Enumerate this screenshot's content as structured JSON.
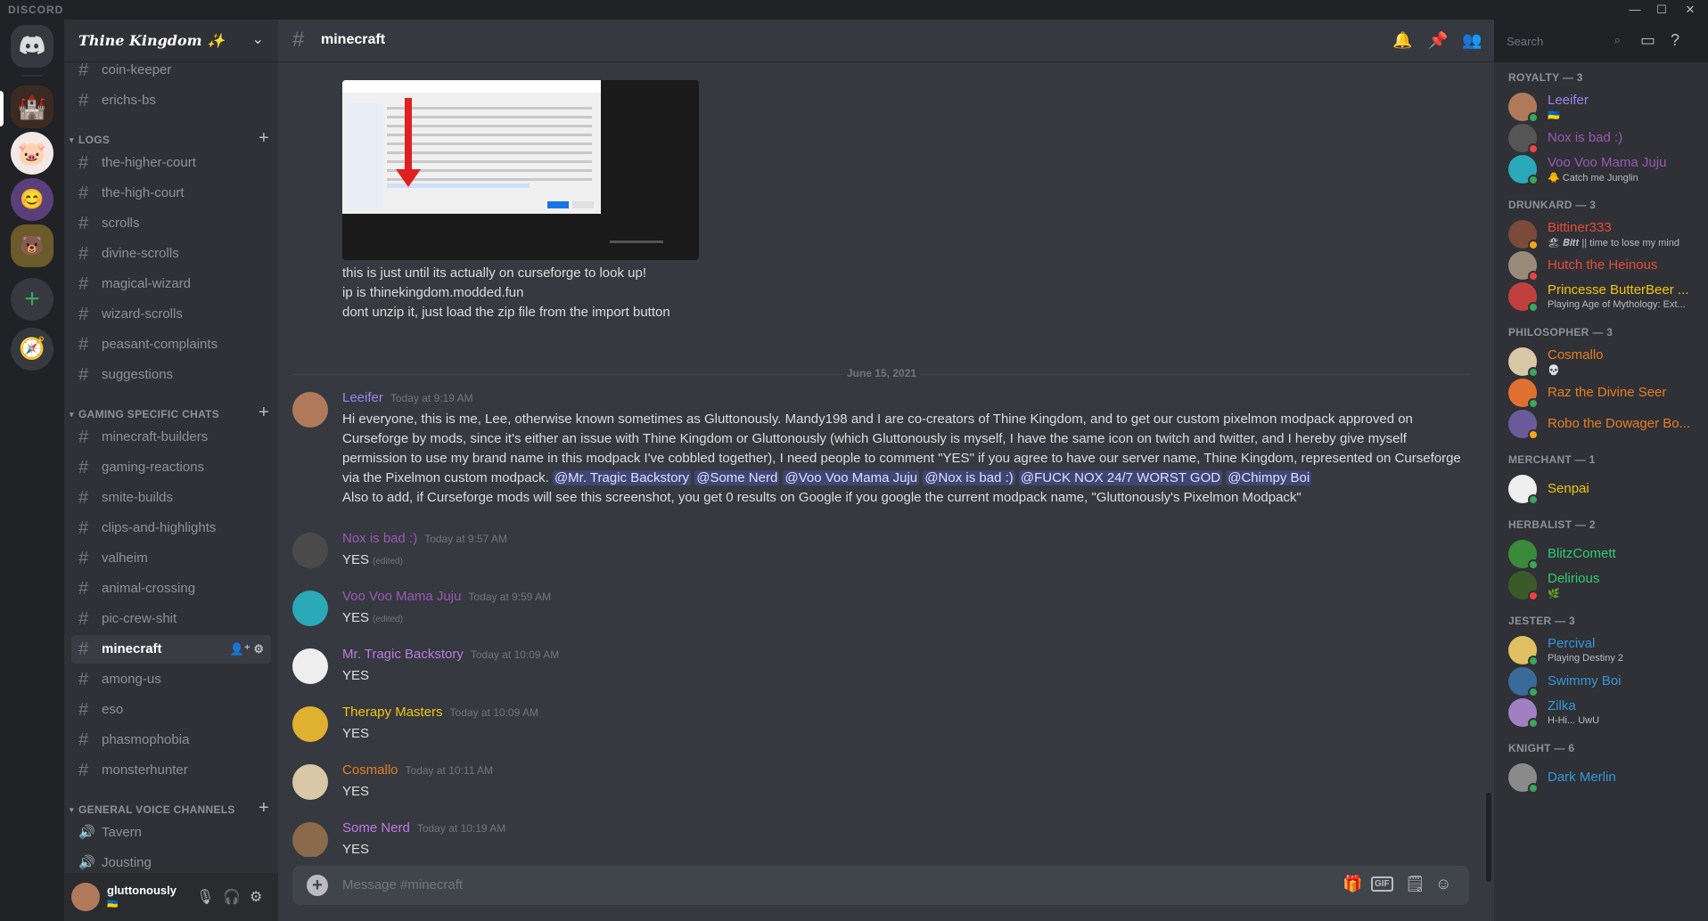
{
  "app": {
    "brand": "DISCORD"
  },
  "server": {
    "name": "𝑻𝒉𝒊𝒏𝒆 𝑲𝒊𝒏𝒈𝒅𝒐𝒎 ✨"
  },
  "channels": {
    "top": [
      "coin-keeper",
      "erichs-bs"
    ],
    "logs_label": "LOGS",
    "logs": [
      "the-higher-court",
      "the-high-court",
      "scrolls",
      "divine-scrolls",
      "magical-wizard",
      "wizard-scrolls",
      "peasant-complaints",
      "suggestions"
    ],
    "gaming_label": "GAMING SPECIFIC CHATS",
    "gaming": [
      "minecraft-builders",
      "gaming-reactions",
      "smite-builds",
      "clips-and-highlights",
      "valheim",
      "animal-crossing",
      "pic-crew-shit",
      "minecraft",
      "among-us",
      "eso",
      "phasmophobia",
      "monsterhunter"
    ],
    "voice_label": "GENERAL VOICE CHANNELS",
    "voice": [
      "Tavern",
      "Jousting"
    ]
  },
  "user": {
    "name": "gluttonously",
    "badge": "🇺🇦"
  },
  "header": {
    "channel": "minecraft",
    "search_placeholder": "Search"
  },
  "attachment_text": [
    "this is just until its actually on curseforge to look up!",
    "ip is thinekingdom.modded.fun",
    "dont unzip it, just load the zip file from the import button"
  ],
  "date_divider": "June 15, 2021",
  "messages": [
    {
      "author": "Leeifer",
      "color": "#9b84ec",
      "time": "Today at 9:19 AM",
      "text": "Hi everyone, this is me, Lee, otherwise known sometimes as Gluttonously. Mandy198 and I are co-creators of Thine Kingdom, and to get our custom pixelmon modpack approved on Curseforge by mods, since it's either an issue with Thine Kingdom or Gluttonously (which Gluttonously is myself, I have the same icon on twitch and twitter, and I hereby give myself permission to use my brand name in this modpack I've cobbled together), I need people to comment \"YES\" if you agree to have our server name, Thine Kingdom, represented on Curseforge via the Pixelmon custom modpack.",
      "mentions": [
        "@Mr. Tragic Backstory",
        "@Some Nerd",
        "@Voo Voo Mama Juju",
        "@Nox is bad :)",
        "@FUCK NOX 24/7 WORST GOD",
        "@Chimpy Boi"
      ],
      "text2": "Also to add, if Curseforge mods will see this screenshot, you get 0 results on Google if you google the current modpack name, \"Gluttonously's Pixelmon Modpack\""
    },
    {
      "author": "Nox is bad :)",
      "color": "#9b59b6",
      "time": "Today at 9:57 AM",
      "text": "YES",
      "edited": "(edited)"
    },
    {
      "author": "Voo Voo Mama Juju",
      "color": "#9b59b6",
      "time": "Today at 9:59 AM",
      "text": "YES",
      "edited": "(edited)"
    },
    {
      "author": "Mr. Tragic Backstory",
      "color": "#b87ce0",
      "time": "Today at 10:09 AM",
      "text": "YES"
    },
    {
      "author": "Therapy Masters",
      "color": "#f1c40f",
      "time": "Today at 10:09 AM",
      "text": "YES"
    },
    {
      "author": "Cosmallo",
      "color": "#e67e22",
      "time": "Today at 10:11 AM",
      "text": "YES"
    },
    {
      "author": "Some Nerd",
      "color": "#c278e8",
      "time": "Today at 10:19 AM",
      "text": "YES"
    }
  ],
  "composer": {
    "placeholder": "Message #minecraft",
    "gif": "GIF"
  },
  "members": [
    {
      "role": "ROYALTY — 3",
      "list": [
        {
          "name": "Leeifer",
          "color": "#9b84ec",
          "status": "🇺🇦",
          "dot": "#3ba55d"
        },
        {
          "name": "Nox is bad :)",
          "color": "#9b59b6",
          "status": "",
          "dot": "#ed4245"
        },
        {
          "name": "Voo Voo Mama Juju",
          "color": "#9b59b6",
          "status": "🐥 Catch me Junglin",
          "dot": "#3ba55d"
        }
      ]
    },
    {
      "role": "DRUNKARD — 3",
      "list": [
        {
          "name": "Bittiner333",
          "color": "#e74c3c",
          "status": "🏖 𝑩𝒊𝒕𝒕 || time to lose my mind",
          "dot": "#faa61a"
        },
        {
          "name": "Hutch the Heinous",
          "color": "#e74c3c",
          "status": "",
          "dot": "#ed4245"
        },
        {
          "name": "Princesse ButterBeer ...",
          "color": "#f1c40f",
          "status": "Playing Age of Mythology: Ext...",
          "dot": "#3ba55d"
        }
      ]
    },
    {
      "role": "PHILOSOPHER — 3",
      "list": [
        {
          "name": "Cosmallo",
          "color": "#e67e22",
          "status": "💀",
          "dot": "#3ba55d"
        },
        {
          "name": "Raz the Divine Seer",
          "color": "#e67e22",
          "status": "",
          "dot": "#3ba55d"
        },
        {
          "name": "Robo the Dowager Bo...",
          "color": "#e67e22",
          "status": "",
          "dot": "#faa61a"
        }
      ]
    },
    {
      "role": "MERCHANT — 1",
      "list": [
        {
          "name": "Senpai",
          "color": "#f1c40f",
          "status": "",
          "dot": "#3ba55d"
        }
      ]
    },
    {
      "role": "HERBALIST — 2",
      "list": [
        {
          "name": "BlitzComett",
          "color": "#2ecc71",
          "status": "",
          "dot": "#3ba55d"
        },
        {
          "name": "Delirious",
          "color": "#2ecc71",
          "status": "🌿",
          "dot": "#ed4245"
        }
      ]
    },
    {
      "role": "JESTER — 3",
      "list": [
        {
          "name": "Percival",
          "color": "#3498db",
          "status": "Playing Destiny 2",
          "dot": "#3ba55d"
        },
        {
          "name": "Swimmy Boi",
          "color": "#3498db",
          "status": "",
          "dot": "#3ba55d"
        },
        {
          "name": "Zilka",
          "color": "#3498db",
          "status": "H-Hi... UwU",
          "dot": "#3ba55d"
        }
      ]
    },
    {
      "role": "KNIGHT — 6",
      "list": [
        {
          "name": "Dark Merlin",
          "color": "#3498db",
          "status": "",
          "dot": "#3ba55d"
        }
      ]
    }
  ]
}
